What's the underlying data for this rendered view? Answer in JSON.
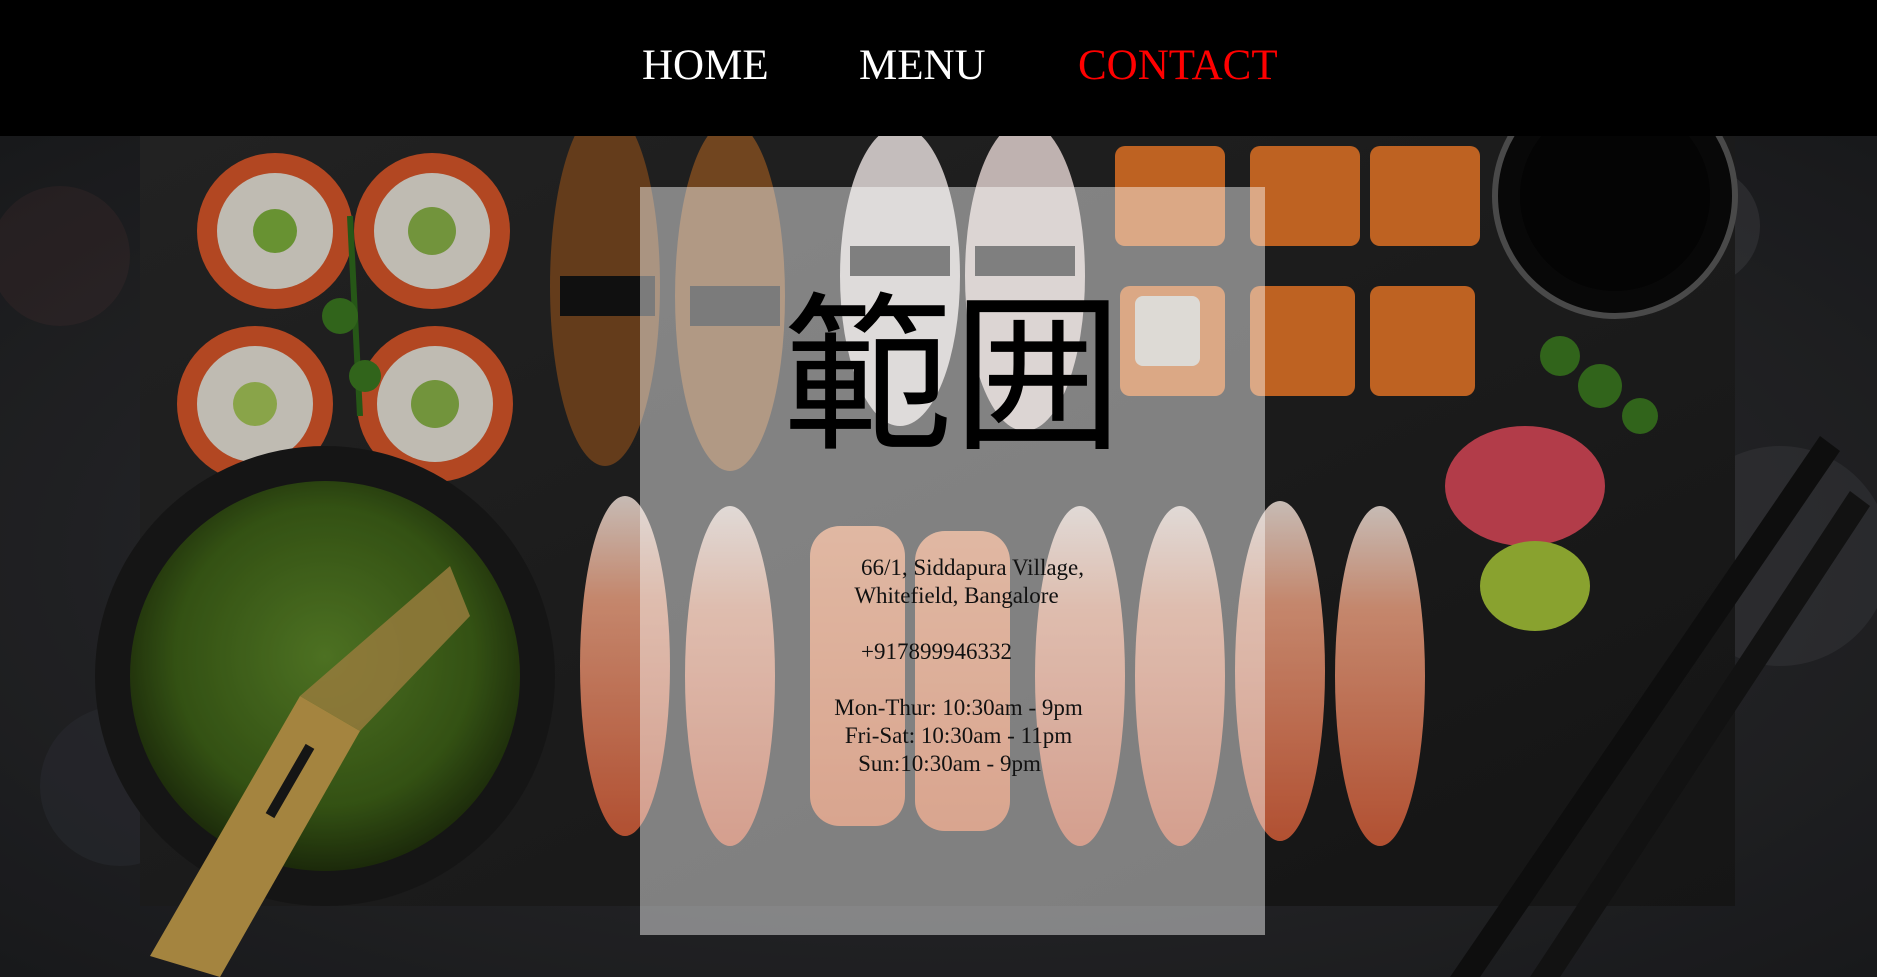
{
  "nav": {
    "items": [
      {
        "label": "HOME",
        "active": false
      },
      {
        "label": "MENU",
        "active": false
      },
      {
        "label": "CONTACT",
        "active": true
      }
    ],
    "active_color": "#ff0000",
    "text_color": "#ffffff",
    "background": "#000000"
  },
  "contact": {
    "logo": "範囲",
    "address_line1": "66/1, Siddapura Village,",
    "address_line2": "Whitefield, Bangalore",
    "phone": "+917899946332",
    "hours": [
      "Mon-Thur: 10:30am - 9pm",
      "Fri-Sat: 10:30am - 11pm",
      "Sun:10:30am - 9pm"
    ]
  },
  "hero": {
    "image": "sushi-platter-photo"
  }
}
